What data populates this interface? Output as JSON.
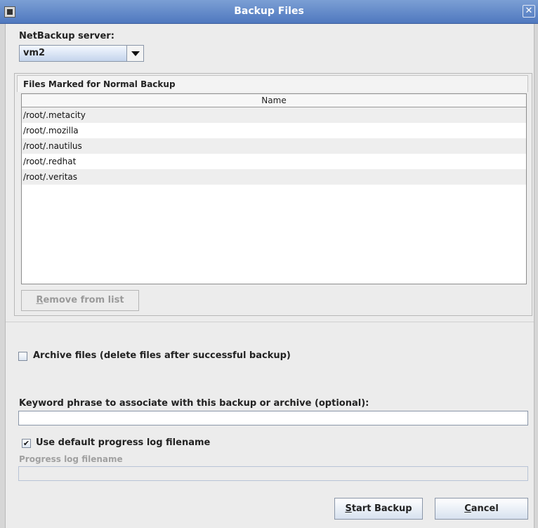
{
  "window": {
    "title": "Backup Files"
  },
  "server": {
    "label": "NetBackup server:",
    "selected": "vm2"
  },
  "files_group": {
    "title": "Files Marked for Normal Backup",
    "column_header": "Name",
    "rows": [
      "/root/.metacity",
      "/root/.mozilla",
      "/root/.nautilus",
      "/root/.redhat",
      "/root/.veritas"
    ],
    "remove_button": {
      "mnemonic": "R",
      "rest": "emove from list"
    }
  },
  "archive": {
    "label": "Archive files (delete files after successful backup)",
    "checked": false
  },
  "keyword": {
    "label": "Keyword phrase to associate with this backup or archive (optional):",
    "value": ""
  },
  "progress_log": {
    "checkbox_label": "Use default progress log filename",
    "checked": true,
    "check_glyph": "✔",
    "filename_label": "Progress log filename",
    "filename_value": ""
  },
  "buttons": {
    "start": {
      "mnemonic": "S",
      "rest": "tart Backup"
    },
    "cancel": {
      "mnemonic": "C",
      "rest": "ancel"
    }
  },
  "icons": {
    "close": "✕"
  }
}
